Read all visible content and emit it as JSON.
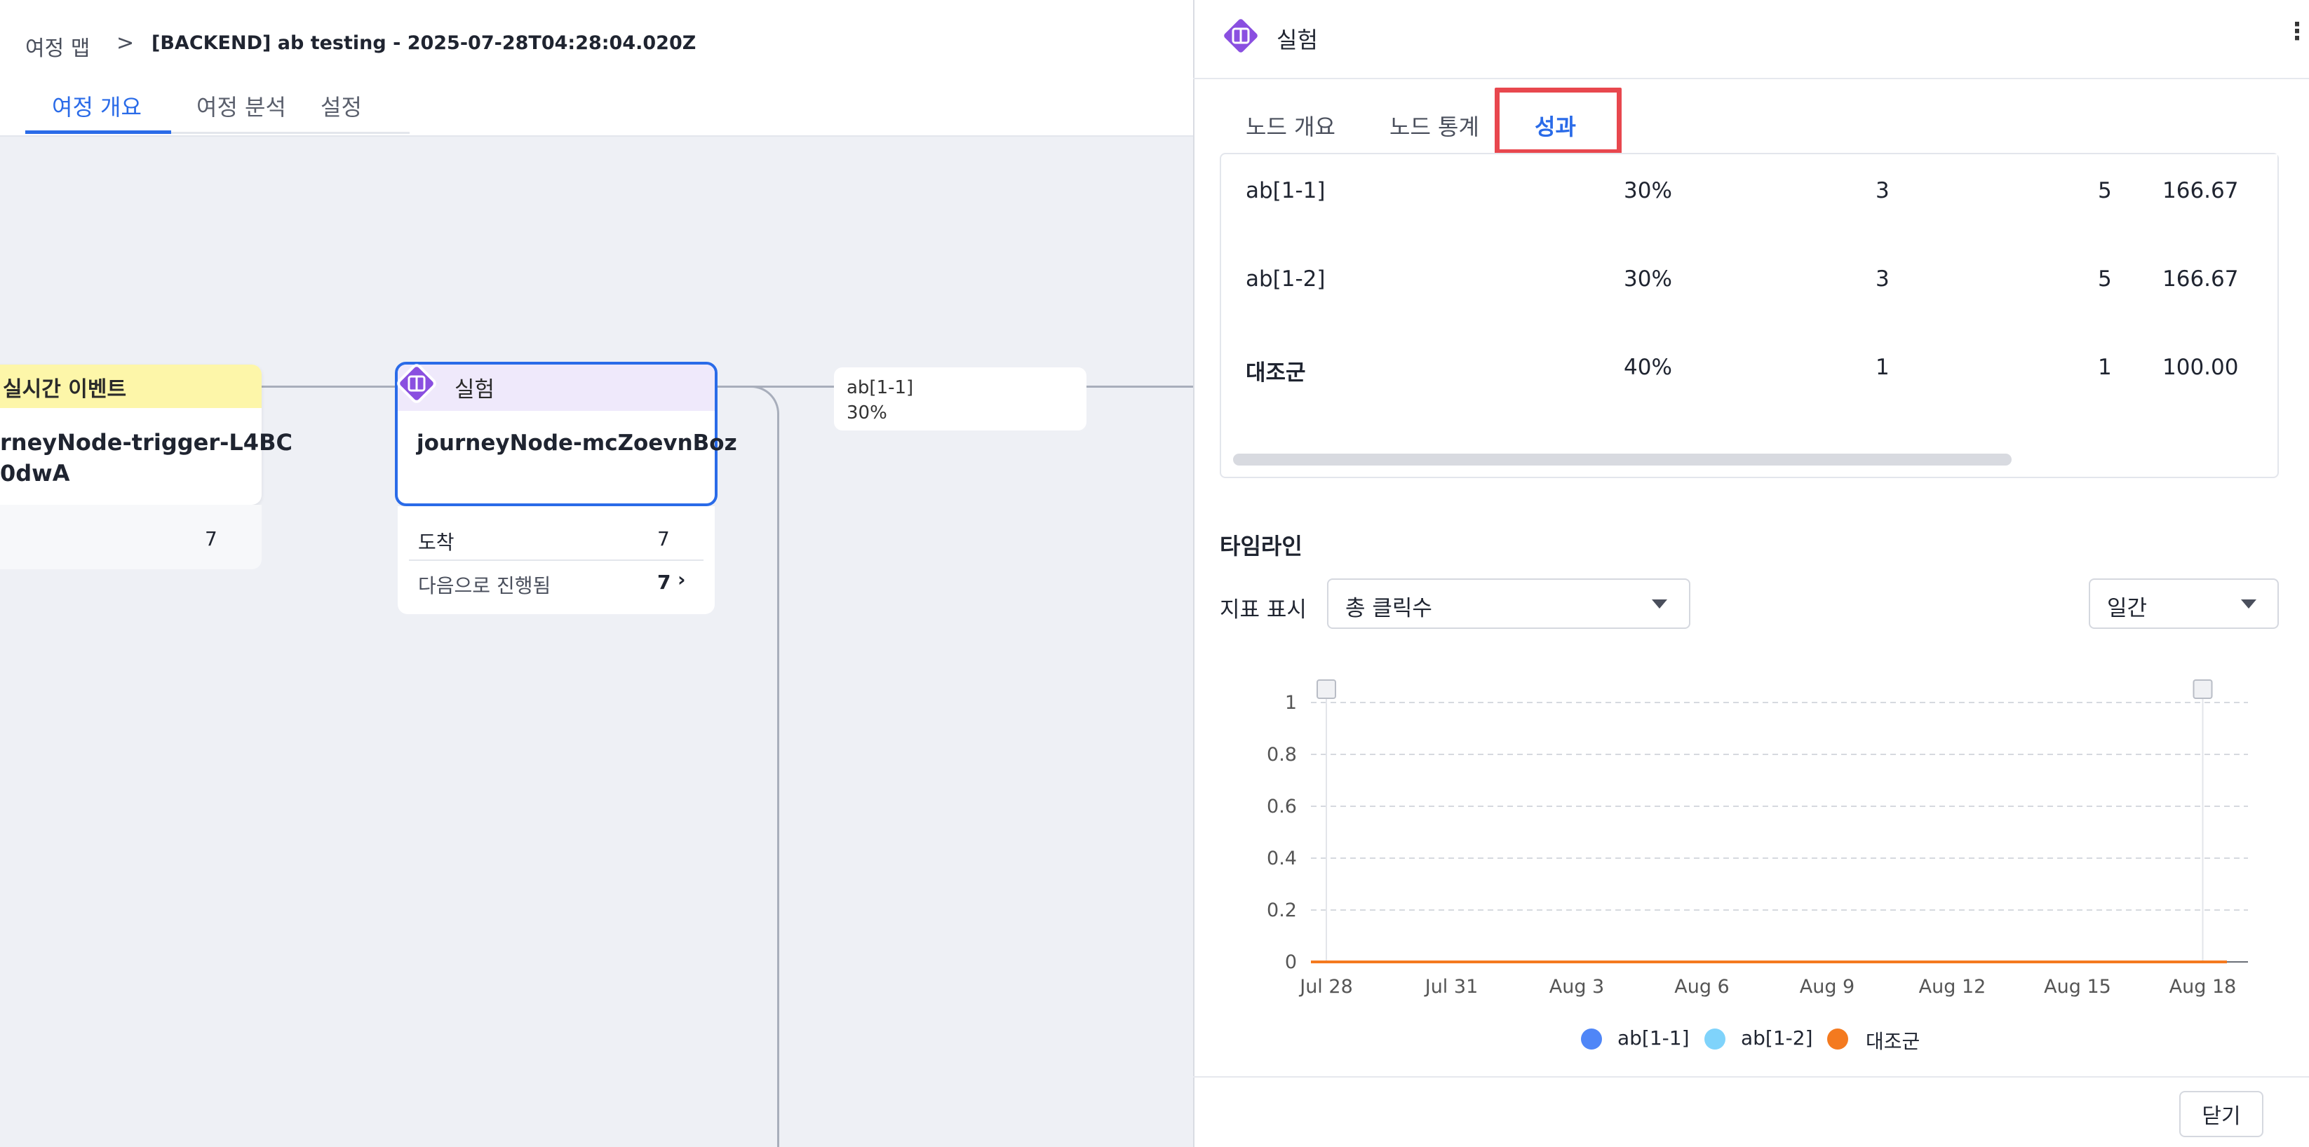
{
  "breadcrumb": {
    "root": "여정 맵",
    "separator": ">",
    "current": "[BACKEND] ab testing - 2025-07-28T04:28:04.020Z"
  },
  "tabs": [
    {
      "label": "여정 개요",
      "active": true
    },
    {
      "label": "여정 분석",
      "active": false
    },
    {
      "label": "설정",
      "active": false
    }
  ],
  "canvas": {
    "trigger_node": {
      "type": "실시간 이벤트",
      "name_line1": "rneyNode-trigger-L4BC",
      "name_line2": "0dwA",
      "count": "7"
    },
    "experiment_node": {
      "type": "실험",
      "name": "journeyNode-mcZoevnBoz",
      "arrived_label": "도착",
      "arrived_count": "7",
      "next_label": "다음으로 진행됨",
      "next_count": "7",
      "next_icon": "chevron-right-icon"
    },
    "branch": {
      "name": "ab[1-1]",
      "percent": "30%"
    }
  },
  "panel": {
    "title": "실험",
    "icon": "experiment-icon",
    "more_icon": "more-vertical-icon",
    "tabs": [
      {
        "label": "노드 개요",
        "active": false
      },
      {
        "label": "노드 통계",
        "active": false
      },
      {
        "label": "성과",
        "active": true
      }
    ],
    "highlight_color": "#e8474e",
    "table": {
      "rows": [
        {
          "name": "ab[1-1]",
          "split": "30%",
          "c1": "3",
          "c2": "5",
          "c3": "166.679"
        },
        {
          "name": "ab[1-2]",
          "split": "30%",
          "c1": "3",
          "c2": "5",
          "c3": "166.679"
        },
        {
          "name": "대조군",
          "split": "40%",
          "c1": "1",
          "c2": "1",
          "c3": "100.009"
        }
      ]
    },
    "timeline": {
      "title": "타임라인",
      "metric_label": "지표 표시",
      "metric_value": "총 클릭수",
      "period_value": "일간"
    },
    "close_label": "닫기"
  },
  "chart_data": {
    "type": "line",
    "x": [
      "Jul 28",
      "Jul 31",
      "Aug 3",
      "Aug 6",
      "Aug 9",
      "Aug 12",
      "Aug 15",
      "Aug 18"
    ],
    "yticks": [
      "0",
      "0.2",
      "0.4",
      "0.6",
      "0.8",
      "1"
    ],
    "ylim": [
      0,
      1
    ],
    "grid": true,
    "legend_position": "bottom",
    "series": [
      {
        "name": "ab[1-1]",
        "color": "#4f86f7",
        "values": [
          0,
          0,
          0,
          0,
          0,
          0,
          0,
          0
        ]
      },
      {
        "name": "ab[1-2]",
        "color": "#7fd3fb",
        "values": [
          0,
          0,
          0,
          0,
          0,
          0,
          0,
          0
        ]
      },
      {
        "name": "대조군",
        "color": "#f47a1f",
        "values": [
          0,
          0,
          0,
          0,
          0,
          0,
          0,
          0
        ]
      }
    ]
  },
  "colors": {
    "accent": "#2a6be8",
    "experiment": "#8a4fe0",
    "trigger_header": "#fdf6a9"
  }
}
